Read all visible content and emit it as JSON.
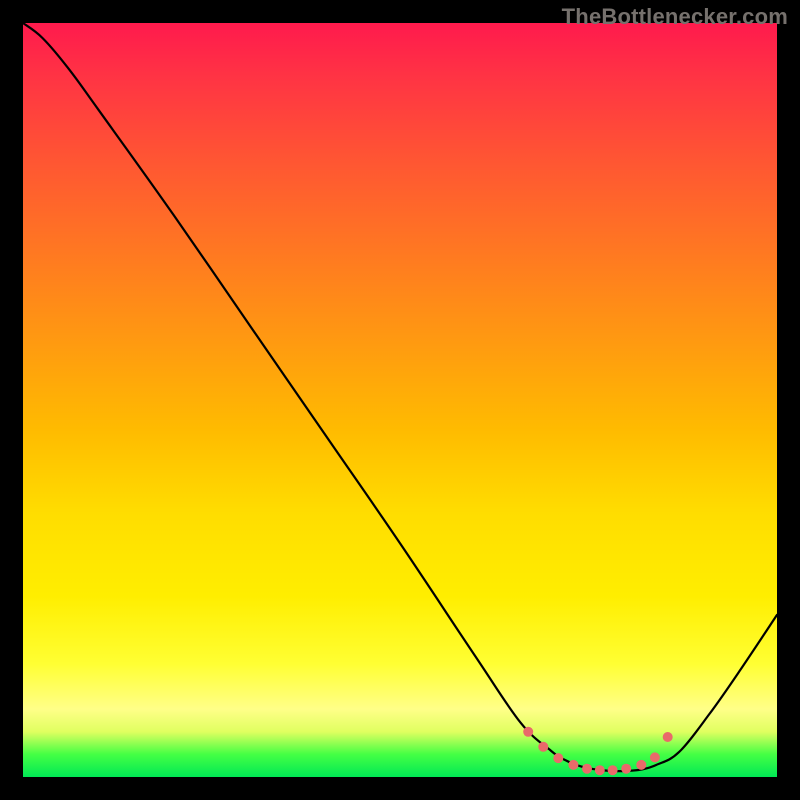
{
  "watermark": "TheBottlenecker.com",
  "chart_data": {
    "type": "line",
    "title": "",
    "xlabel": "",
    "ylabel": "",
    "xlim": [
      0,
      1
    ],
    "ylim": [
      0,
      1
    ],
    "series": [
      {
        "name": "curve",
        "x": [
          0.0,
          0.026,
          0.06,
          0.1,
          0.2,
          0.3,
          0.4,
          0.5,
          0.6,
          0.66,
          0.7,
          0.72,
          0.74,
          0.76,
          0.78,
          0.8,
          0.82,
          0.84,
          0.87,
          0.91,
          0.95,
          1.0
        ],
        "y": [
          1.0,
          0.98,
          0.94,
          0.885,
          0.745,
          0.6,
          0.455,
          0.31,
          0.16,
          0.072,
          0.035,
          0.022,
          0.014,
          0.01,
          0.008,
          0.008,
          0.01,
          0.016,
          0.033,
          0.083,
          0.14,
          0.215
        ],
        "color": "#000000"
      },
      {
        "name": "dots",
        "type": "scatter",
        "x": [
          0.67,
          0.69,
          0.71,
          0.73,
          0.748,
          0.765,
          0.782,
          0.8,
          0.82,
          0.838,
          0.855
        ],
        "y": [
          0.06,
          0.04,
          0.025,
          0.016,
          0.011,
          0.009,
          0.009,
          0.011,
          0.016,
          0.026,
          0.053
        ],
        "color": "#e96a6a",
        "size": 5
      }
    ]
  }
}
